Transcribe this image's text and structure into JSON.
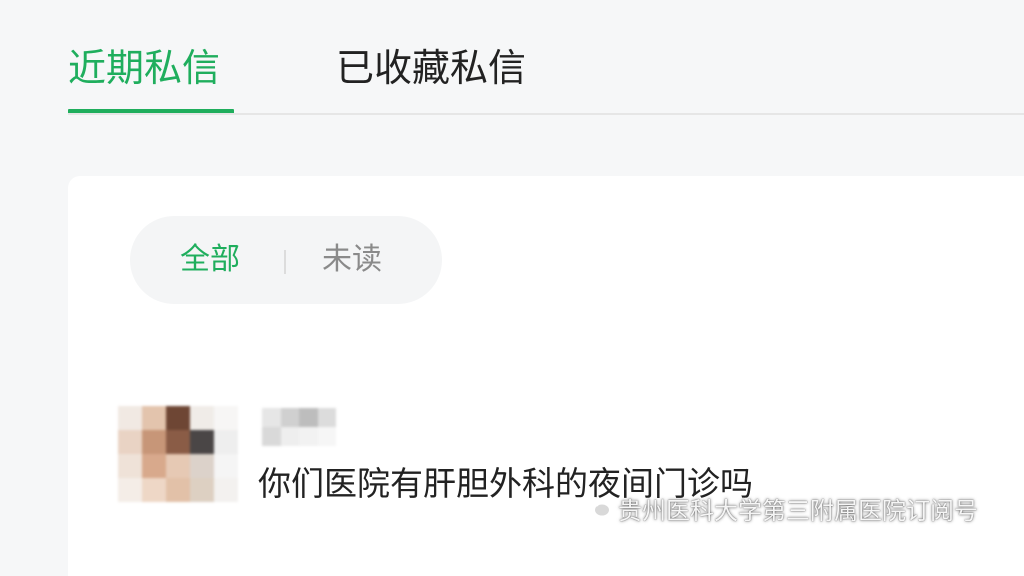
{
  "tabs": {
    "recent_label": "近期私信",
    "favorites_label": "已收藏私信",
    "active_color": "#1fae5d"
  },
  "filter": {
    "all_label": "全部",
    "unread_label": "未读",
    "active": "全部"
  },
  "messages": [
    {
      "sender_name": "",
      "preview": "你们医院有肝胆外科的夜间门诊吗",
      "avatar_icon": "pixelated-avatar-icon"
    }
  ],
  "watermark": {
    "text": "贵州医科大学第三附属医院订阅号",
    "icon": "wechat-logo-icon"
  }
}
